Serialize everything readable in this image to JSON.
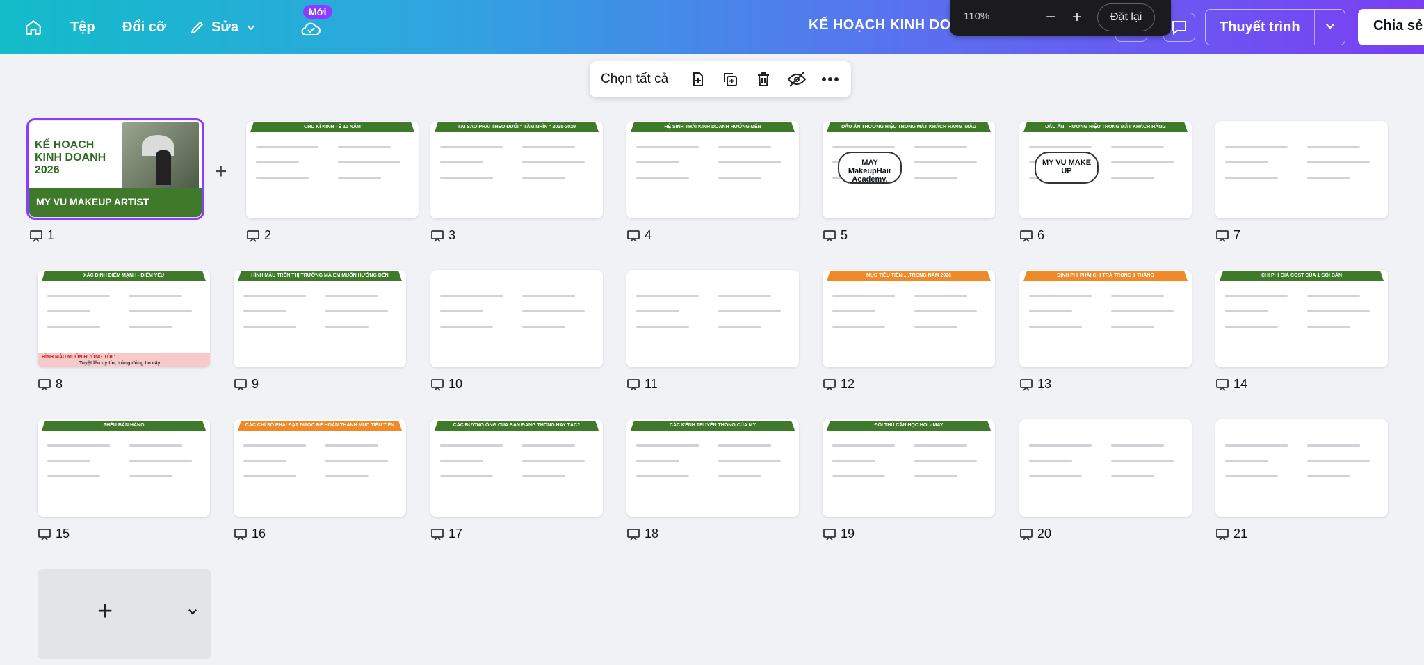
{
  "topbar": {
    "home_icon": "home-icon",
    "file_label": "Tệp",
    "resize_label": "Đổi cỡ",
    "edit_label": "Sửa",
    "new_badge": "Mới",
    "doc_title": "KẾ HOẠCH KINH DOANH",
    "present_label": "Thuyết trình",
    "share_label": "Chia sẻ"
  },
  "zoom": {
    "value": "110%",
    "reset_label": "Đặt lại"
  },
  "context_bar": {
    "select_all_label": "Chọn tất cả"
  },
  "slides": [
    {
      "num": "1",
      "title": "KẾ HOẠCH KINH DOANH 2026",
      "subtitle": "MY VU MAKEUP ARTIST"
    },
    {
      "num": "2",
      "title": "CHU KÌ KINH TẾ 10 NĂM"
    },
    {
      "num": "3",
      "title": "TẠI SAO PHẢI THEO ĐUỔI \" TẦM NHÌN \" 2025-2029"
    },
    {
      "num": "4",
      "title": "HỆ SINH THÁI KINH DOANH HƯỚNG ĐẾN"
    },
    {
      "num": "5",
      "title": "DẤU ẤN THƯƠNG HIỆU TRONG MẮT KHÁCH HÀNG -MẪU",
      "body": "MAY MakeupHair Academy."
    },
    {
      "num": "6",
      "title": "DẤU ẤN THƯƠNG HIỆU TRONG MẮT KHÁCH HÀNG",
      "body": "MY VU MAKE UP"
    },
    {
      "num": "7",
      "title": ""
    },
    {
      "num": "8",
      "title": "XÁC ĐỊNH ĐIỂM MẠNH - ĐIỂM YẾU",
      "footer": "HÌNH MẪU MUỐN HƯỚNG TỚI :",
      "footer2": "Tuyệt lên uy tín, trứng đúng tin cậy"
    },
    {
      "num": "9",
      "title": "HÌNH MẪU TRÊN THỊ TRƯỜNG MÀ EM MUỐN HƯỚNG ĐẾN"
    },
    {
      "num": "10",
      "title": ""
    },
    {
      "num": "11",
      "title": ""
    },
    {
      "num": "12",
      "title": "MỤC TIÊU TIỀN.....TRONG NĂM 2026"
    },
    {
      "num": "13",
      "title": "ĐỊNH PHÍ PHẢI CHI TRẢ TRONG 1 THÁNG"
    },
    {
      "num": "14",
      "title": "CHI PHÍ GIÁ COST CỦA 1 GÓI BÁN"
    },
    {
      "num": "15",
      "title": "PHỄU BÁN HÀNG"
    },
    {
      "num": "16",
      "title": "CÁC CHỈ SỐ PHẢI ĐẠT ĐƯỢC ĐỂ HOÀN THÀNH MỤC TIÊU TIỀN"
    },
    {
      "num": "17",
      "title": "CÁC ĐƯỜNG ỐNG CỦA BẠN ĐANG THÔNG HAY TẮC?"
    },
    {
      "num": "18",
      "title": "CÁC KÊNH TRUYỀN THÔNG CỦA MY"
    },
    {
      "num": "19",
      "title": "ĐỐI THỦ CẦN HỌC HỎI - MAY"
    },
    {
      "num": "20",
      "title": ""
    },
    {
      "num": "21",
      "title": ""
    }
  ],
  "colors": {
    "accent": "#8b3dff",
    "slide_green": "#3f7a2a",
    "slide_orange": "#ef8a2a"
  }
}
